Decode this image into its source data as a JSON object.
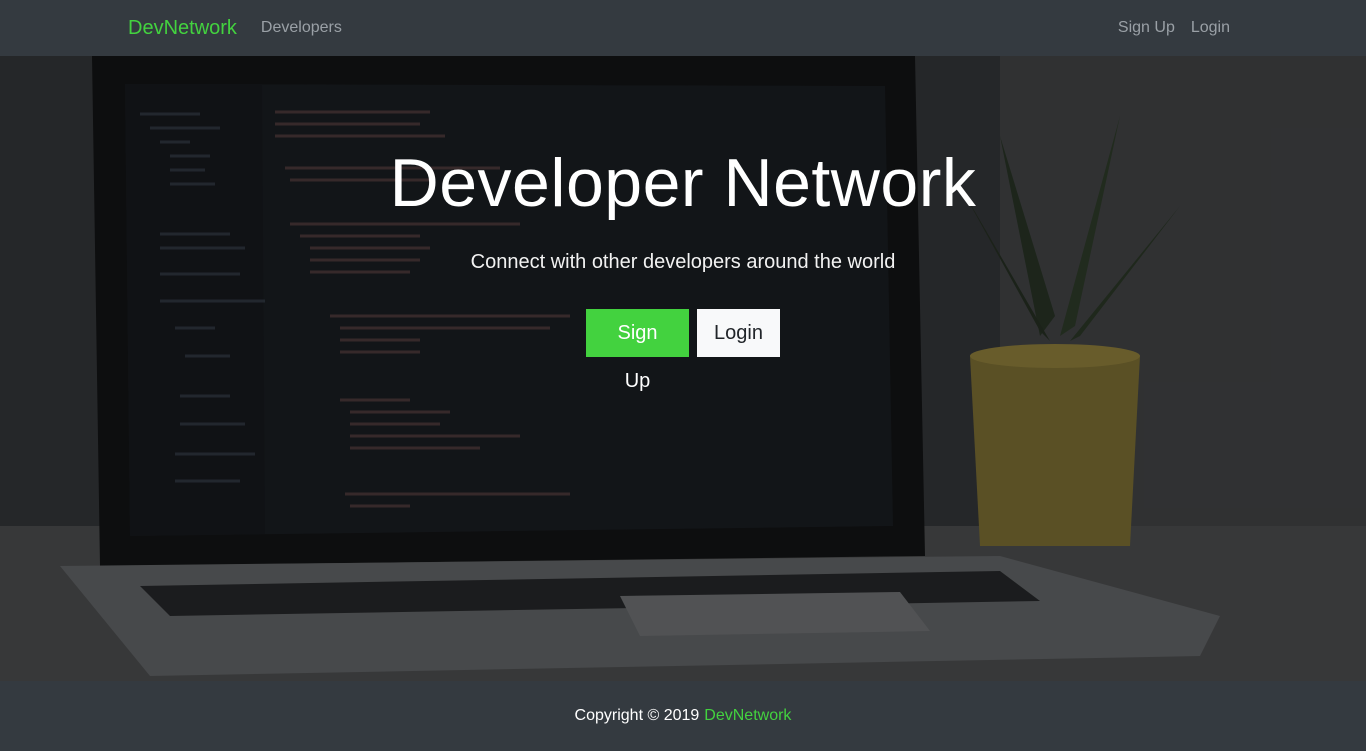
{
  "navbar": {
    "brand": "DevNetwork",
    "links_left": [
      "Developers"
    ],
    "links_right": [
      "Sign Up",
      "Login"
    ]
  },
  "hero": {
    "title": "Developer Network",
    "lead": "Connect with other developers around the world",
    "primary_button": "Sign Up",
    "secondary_button": "Login"
  },
  "footer": {
    "copyright": "Copyright © 2019",
    "brand": "DevNetwork"
  },
  "colors": {
    "accent": "#43d23f",
    "nav_bg": "#343a40",
    "footer_bg": "#343a40"
  }
}
